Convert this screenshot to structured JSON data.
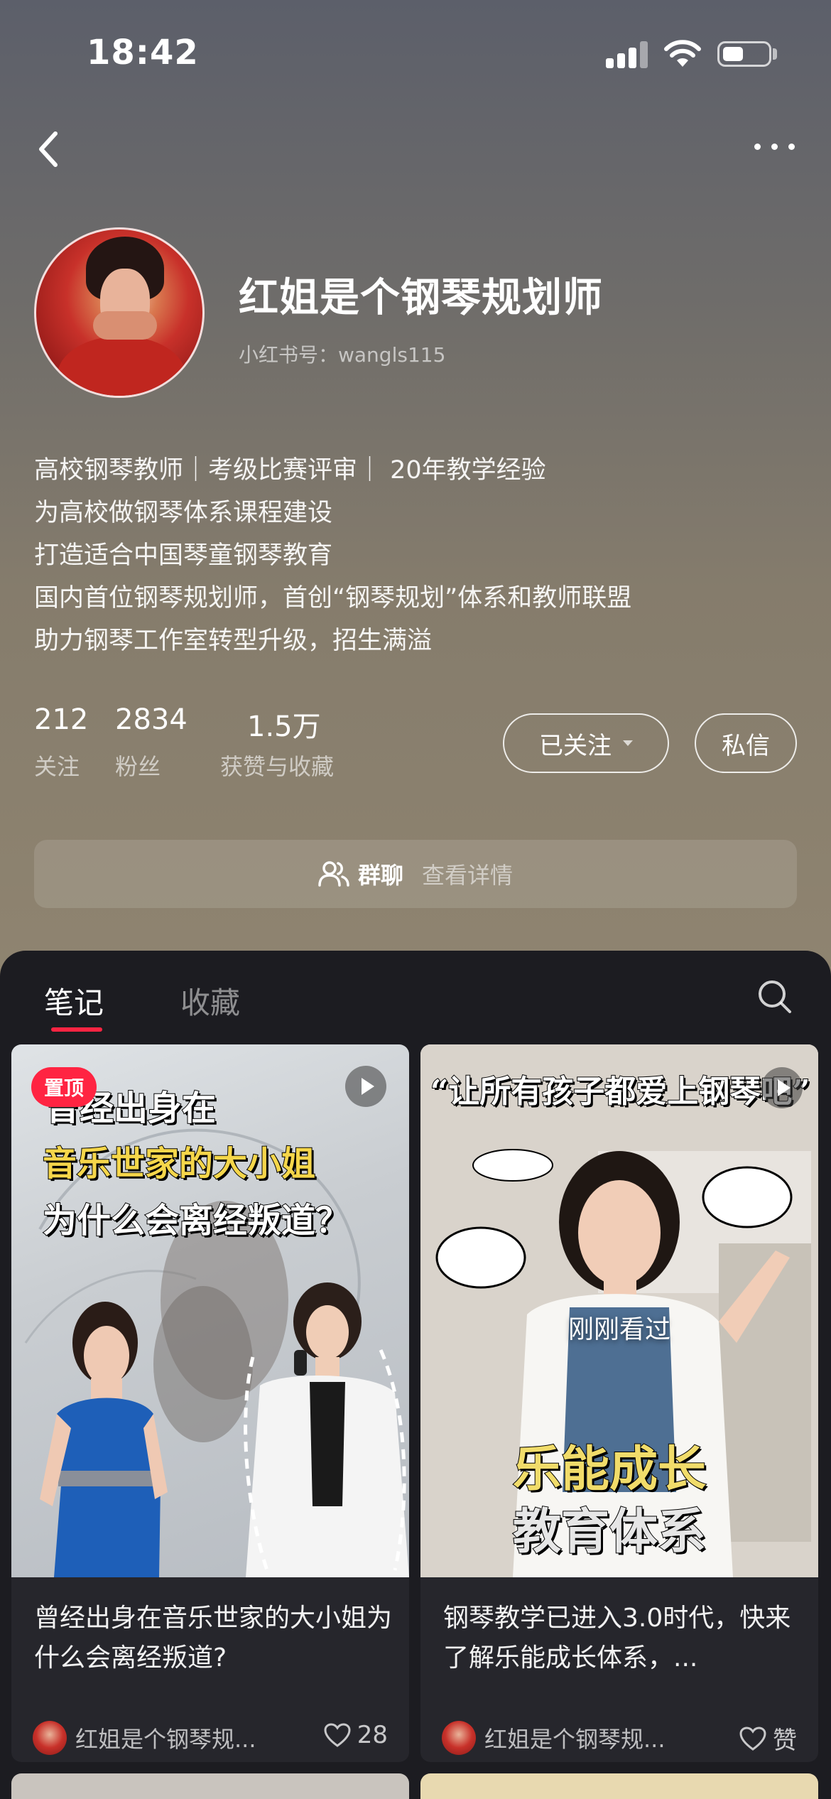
{
  "status_bar": {
    "time": "18:42"
  },
  "profile": {
    "name": "红姐是个钢琴规划师",
    "red_id": "小红书号：wangls115",
    "bio": [
      "高校钢琴教师｜考级比赛评审｜ 20年教学经验",
      "为高校做钢琴体系课程建设",
      "打造适合中国琴童钢琴教育",
      "国内首位钢琴规划师，首创“钢琴规划”体系和教师联盟",
      "助力钢琴工作室转型升级，招生满溢"
    ],
    "stats": [
      {
        "value": "212",
        "label": "关注"
      },
      {
        "value": "2834",
        "label": "粉丝"
      },
      {
        "value": "1.5万",
        "label": "获赞与收藏"
      }
    ],
    "follow_button": "已关注",
    "message_button": "私信",
    "group_chat": {
      "label": "群聊",
      "detail": "查看详情"
    }
  },
  "tabs": {
    "notes": "笔记",
    "collections": "收藏"
  },
  "notes": [
    {
      "pinned_label": "置顶",
      "cover_lines": [
        "曾经出身在",
        "音乐世家的大小姐",
        "为什么会离经叛道？"
      ],
      "title": "曾经出身在音乐世家的大小姐为什么会离经叛道?",
      "author": "红姐是个钢琴规...",
      "likes": "28"
    },
    {
      "cover_top": "“让所有孩子都爱上钢琴吧”",
      "cover_bottom": [
        "乐能成长",
        "教育体系"
      ],
      "seen_label": "刚刚看过",
      "title": "钢琴教学已进入3.0时代，快来了解乐能成长体系，...",
      "author": "红姐是个钢琴规...",
      "likes": "赞"
    }
  ]
}
